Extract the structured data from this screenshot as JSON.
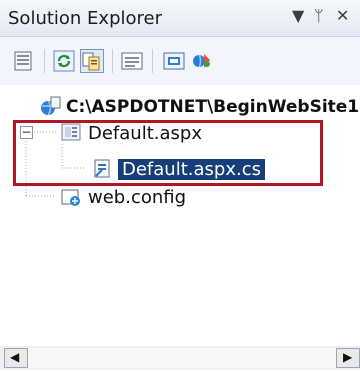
{
  "panel": {
    "title": "Solution Explorer",
    "pin_glyph": "▼",
    "pushpin_glyph": "ᛘ",
    "close_glyph": "✕"
  },
  "toolbar": {
    "buttons": [
      {
        "name": "properties-icon"
      },
      {
        "name": "refresh-icon"
      },
      {
        "name": "show-all-files-icon"
      },
      {
        "name": "view-code-icon"
      },
      {
        "name": "view-designer-icon"
      },
      {
        "name": "asp-net-config-icon"
      }
    ]
  },
  "tree": {
    "root": "C:\\ASPDOTNET\\BeginWebSite1",
    "items": [
      {
        "label": "Default.aspx",
        "expander": "−"
      },
      {
        "label": "Default.aspx.cs",
        "selected": true
      },
      {
        "label": "web.config"
      }
    ]
  },
  "colors": {
    "selection": "#163f7a",
    "highlight_border": "#b21621"
  },
  "scroll": {
    "left_arrow": "◀",
    "right_arrow": "▶"
  }
}
